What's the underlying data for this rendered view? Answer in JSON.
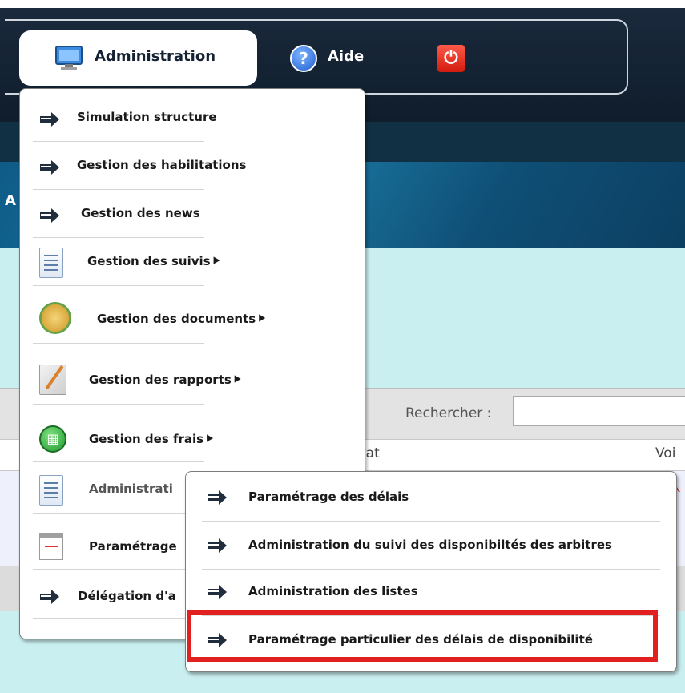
{
  "navbar": {
    "administration_label": "Administration",
    "aide_label": "Aide",
    "aide_icon_glyph": "?",
    "power_icon": "power-icon"
  },
  "banner": {
    "partial_letter": "A"
  },
  "table": {
    "search_label": "Rechercher :",
    "search_value": "",
    "columns": [
      "tat",
      "Voi"
    ]
  },
  "menu": {
    "items": [
      {
        "label": "Simulation structure",
        "icon": "arrow-right-icon",
        "has_submenu": false
      },
      {
        "label": "Gestion des habilitations",
        "icon": "arrow-right-icon",
        "has_submenu": false
      },
      {
        "label": "Gestion des news",
        "icon": "arrow-right-icon",
        "has_submenu": false
      },
      {
        "label": "Gestion des suivis",
        "icon": "document-icon",
        "has_submenu": true
      },
      {
        "label": "Gestion des documents",
        "icon": "documents-icon",
        "has_submenu": true
      },
      {
        "label": "Gestion des rapports",
        "icon": "report-icon",
        "has_submenu": true
      },
      {
        "label": "Gestion des frais",
        "icon": "calculator-icon",
        "has_submenu": true
      },
      {
        "label": "Administrati",
        "icon": "document-icon",
        "has_submenu": true
      },
      {
        "label": "Paramétrage",
        "icon": "calendar-icon",
        "has_submenu": true
      },
      {
        "label": "Délégation d'a",
        "icon": "arrow-right-icon",
        "has_submenu": false
      }
    ],
    "submenu_glyph": "⯈"
  },
  "submenu": {
    "items": [
      {
        "label": "Paramétrage des délais"
      },
      {
        "label": "Administration du suivi des disponibiltés des arbitres"
      },
      {
        "label": "Administration des listes"
      },
      {
        "label": "Paramétrage particulier des délais de disponibilité",
        "highlighted": true
      }
    ]
  },
  "colors": {
    "highlight": "#e32020",
    "topbar": "#1b2a3d",
    "light_area": "#c9eff0"
  }
}
